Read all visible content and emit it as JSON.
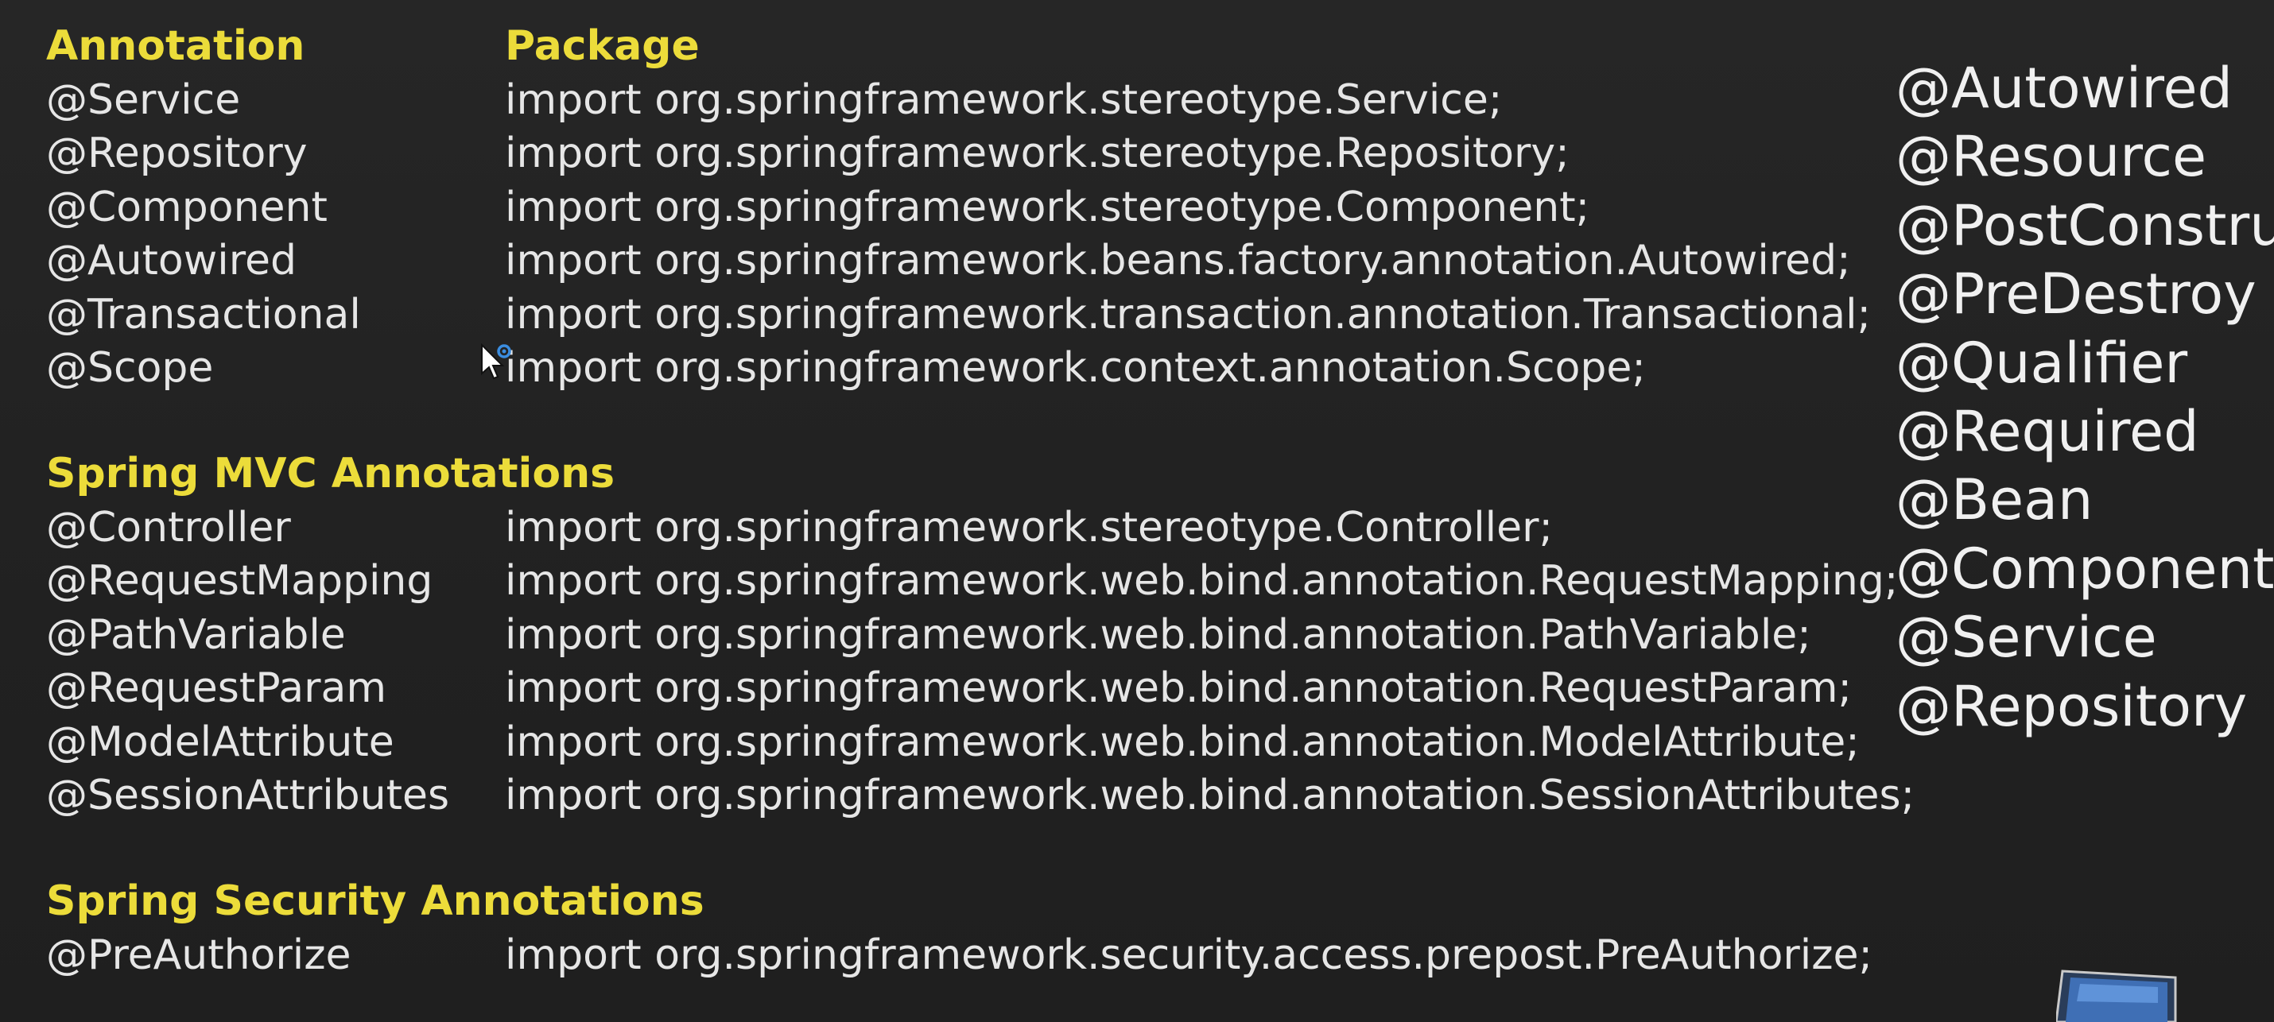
{
  "core": {
    "header": {
      "annotation": "Annotation",
      "package": "Package"
    },
    "rows": [
      {
        "annotation": "@Service",
        "package": "import org.springframework.stereotype.Service;"
      },
      {
        "annotation": "@Repository",
        "package": "import org.springframework.stereotype.Repository;"
      },
      {
        "annotation": "@Component",
        "package": "import org.springframework.stereotype.Component;"
      },
      {
        "annotation": "@Autowired",
        "package": "import org.springframework.beans.factory.annotation.Autowired;"
      },
      {
        "annotation": "@Transactional",
        "package": "import org.springframework.transaction.annotation.Transactional;"
      },
      {
        "annotation": "@Scope",
        "package": "import org.springframework.context.annotation.Scope;"
      }
    ]
  },
  "mvc": {
    "title": "Spring MVC Annotations",
    "rows": [
      {
        "annotation": "@Controller",
        "package": "import org.springframework.stereotype.Controller;"
      },
      {
        "annotation": "@RequestMapping",
        "package": "import org.springframework.web.bind.annotation.RequestMapping;"
      },
      {
        "annotation": "@PathVariable",
        "package": "import org.springframework.web.bind.annotation.PathVariable;"
      },
      {
        "annotation": "@RequestParam",
        "package": "import org.springframework.web.bind.annotation.RequestParam;"
      },
      {
        "annotation": "@ModelAttribute",
        "package": "import org.springframework.web.bind.annotation.ModelAttribute;"
      },
      {
        "annotation": "@SessionAttributes",
        "package": "import org.springframework.web.bind.annotation.SessionAttributes;"
      }
    ]
  },
  "security": {
    "title": "Spring Security Annotations",
    "rows": [
      {
        "annotation": "@PreAuthorize",
        "package": "import org.springframework.security.access.prepost.PreAuthorize;"
      }
    ]
  },
  "right_list": [
    "@Autowired",
    "@Resource",
    "@PostConstruct",
    "@PreDestroy",
    "@Qualifier",
    "@Required",
    "@Bean",
    "@Component",
    "@Service",
    "@Repository"
  ],
  "colors": {
    "background": "#232323",
    "heading": "#ecdc3a",
    "text": "#e6e6e6"
  },
  "icons": {
    "cursor": "mouse-pointer-busy-icon",
    "corner": "window-thumbnail-icon"
  }
}
